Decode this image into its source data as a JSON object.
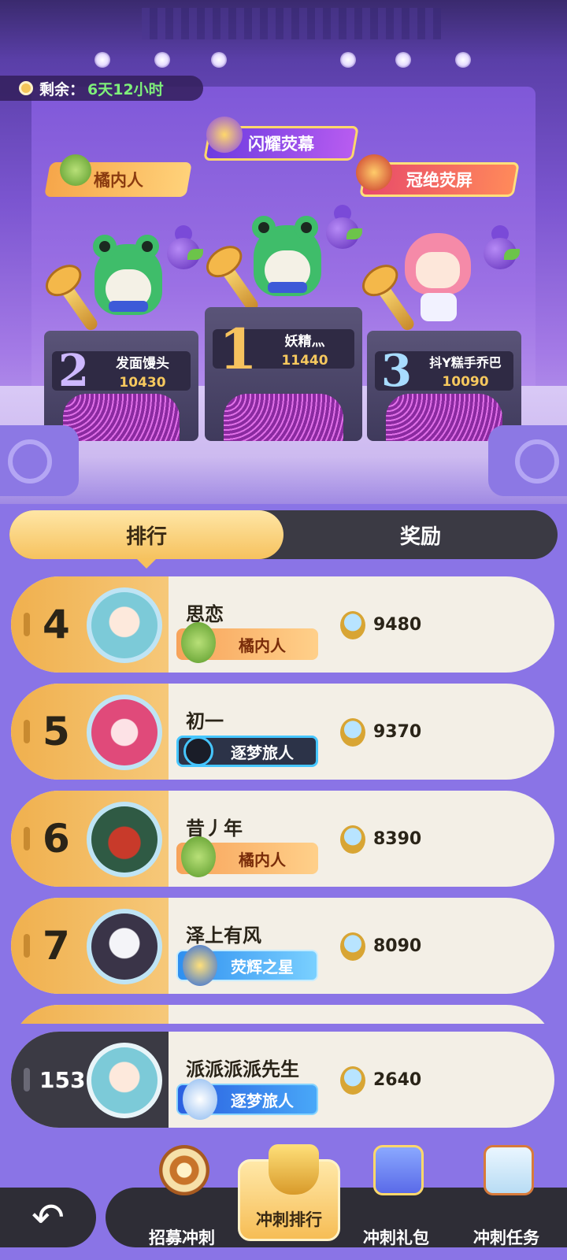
{
  "timer": {
    "label": "剩余：",
    "value": "6天12小时"
  },
  "banners": {
    "left": "橘内人",
    "middle": "闪耀荧幕",
    "right": "冠绝荧屏"
  },
  "podium": [
    {
      "rank": "2",
      "name": "发面馒头",
      "score": "10430"
    },
    {
      "rank": "1",
      "name": "妖精灬",
      "score": "11440"
    },
    {
      "rank": "3",
      "name": "抖Y糕手乔巴",
      "score": "10090"
    }
  ],
  "tabs": {
    "ranking": "排行",
    "rewards": "奖励"
  },
  "rows": [
    {
      "rank": "4",
      "name": "思恋",
      "title": "橘内人",
      "score": "9480"
    },
    {
      "rank": "5",
      "name": "初一",
      "title": "逐梦旅人",
      "score": "9370"
    },
    {
      "rank": "6",
      "name": "昔丿年",
      "title": "橘内人",
      "score": "8390"
    },
    {
      "rank": "7",
      "name": "泽上有风",
      "title": "荧辉之星",
      "score": "8090"
    }
  ],
  "me": {
    "rank": "153",
    "name": "派派派派先生",
    "title": "逐梦旅人",
    "score": "2640"
  },
  "nav": [
    {
      "label": "招募冲刺",
      "icon": "target-dart-icon"
    },
    {
      "label": "冲刺排行",
      "icon": "trophy-icon"
    },
    {
      "label": "冲刺礼包",
      "icon": "gift-box-icon"
    },
    {
      "label": "冲刺任务",
      "icon": "clipboard-icon"
    }
  ],
  "colors": {
    "accent_gold": "#f6c25e",
    "bg_purple": "#8a74e6",
    "dark_pill": "#3b3a44"
  }
}
